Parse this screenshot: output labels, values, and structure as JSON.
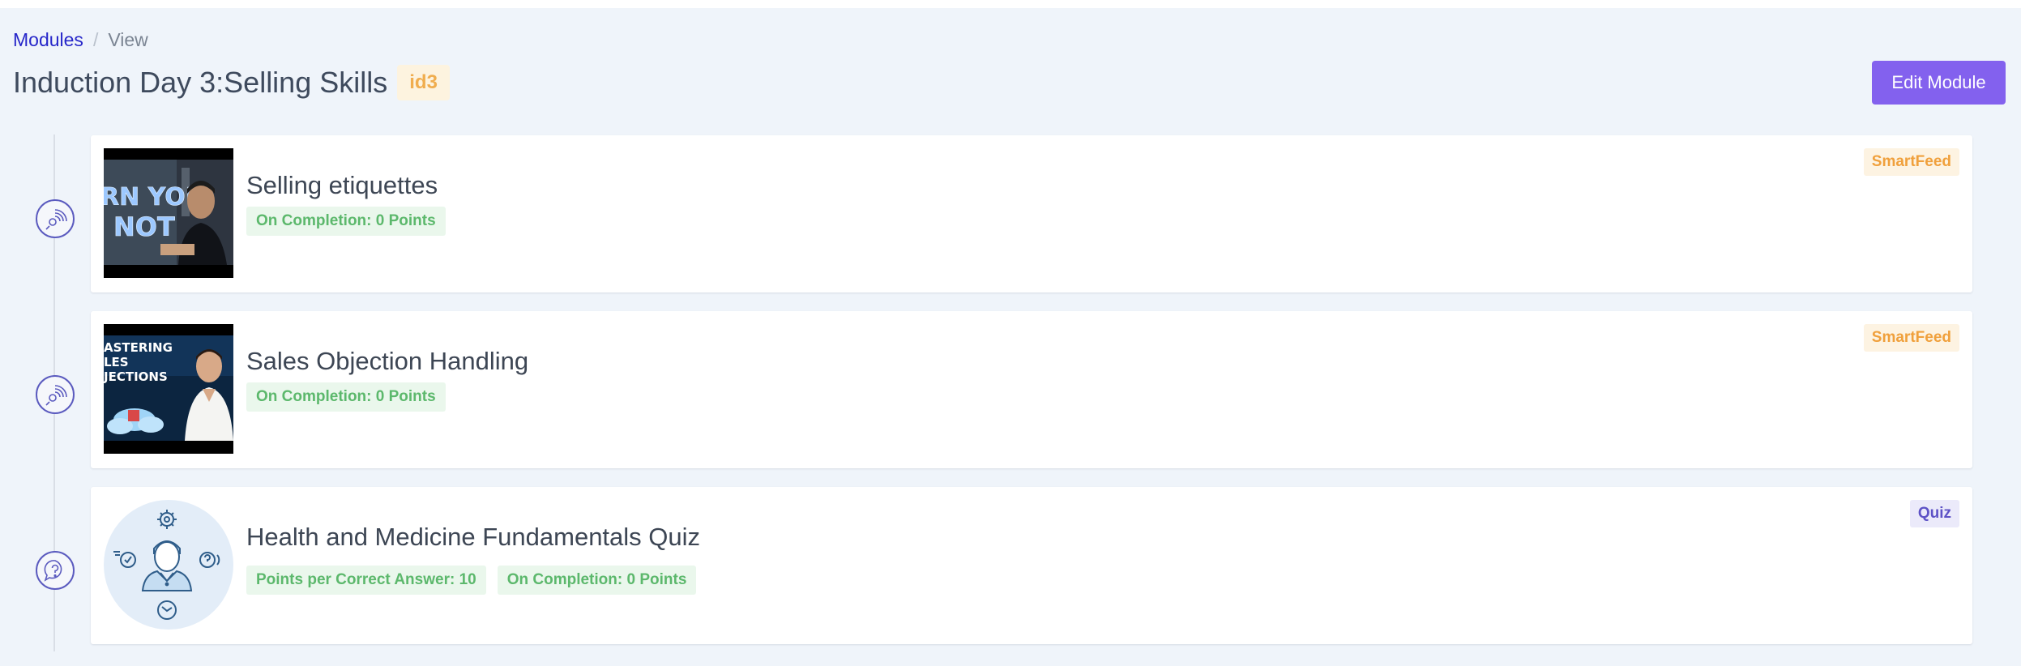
{
  "breadcrumb": {
    "link_label": "Modules",
    "current_label": "View"
  },
  "header": {
    "title": "Induction Day 3:Selling Skills",
    "id_badge": "id3",
    "edit_button_label": "Edit Module"
  },
  "items": [
    {
      "title": "Selling etiquettes",
      "type_label": "SmartFeed",
      "icon": "smartfeed-icon",
      "thumbnail_text": [
        "RN YOU",
        "NOT"
      ],
      "badges": [
        "On Completion: 0 Points"
      ]
    },
    {
      "title": "Sales Objection Handling",
      "type_label": "SmartFeed",
      "icon": "smartfeed-icon",
      "thumbnail_text": [
        "ASTERING",
        "LES",
        "JECTIONS"
      ],
      "badges": [
        "On Completion: 0 Points"
      ]
    },
    {
      "title": "Health and Medicine Fundamentals Quiz",
      "type_label": "Quiz",
      "icon": "quiz-icon",
      "badges": [
        "Points per Correct Answer: 10",
        "On Completion: 0 Points"
      ]
    }
  ],
  "colors": {
    "accent": "#8361ee",
    "link": "#2626c9",
    "smartfeed": "#f0a03c",
    "quiz": "#5d52c6",
    "points": "#5cb86c",
    "background": "#eff4fa"
  }
}
